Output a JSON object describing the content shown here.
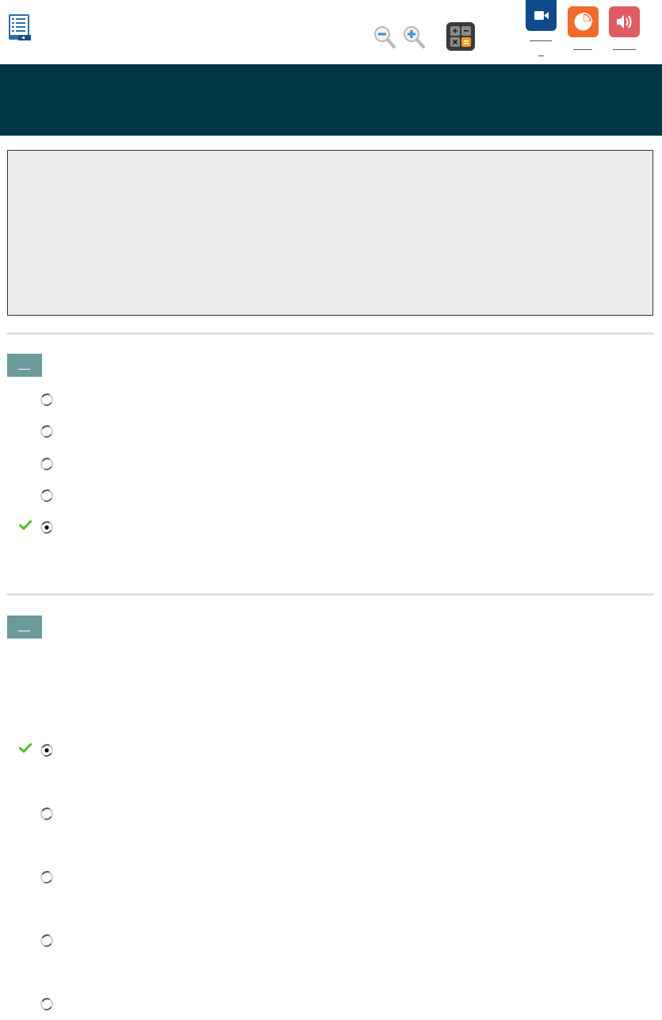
{
  "toolbar": {
    "icons": [
      "table-of-contents-icon",
      "zoom-out-icon",
      "zoom-in-icon",
      "calculator-icon",
      "video-icon",
      "chart-icon",
      "audio-icon"
    ]
  },
  "colors": {
    "banner": "#023747",
    "video": "#0e4a8c",
    "chart": "#f06a2c",
    "audio": "#e05c63",
    "question_number_bg": "#6a9a9a",
    "passage_bg": "#ececec",
    "check": "#55bb2a"
  },
  "questions": [
    {
      "options": [
        {
          "selected": false,
          "correct_mark": false
        },
        {
          "selected": false,
          "correct_mark": false
        },
        {
          "selected": false,
          "correct_mark": false
        },
        {
          "selected": false,
          "correct_mark": false
        },
        {
          "selected": true,
          "correct_mark": true
        }
      ]
    },
    {
      "options": [
        {
          "selected": true,
          "correct_mark": true
        },
        {
          "selected": false,
          "correct_mark": false
        },
        {
          "selected": false,
          "correct_mark": false
        },
        {
          "selected": false,
          "correct_mark": false
        },
        {
          "selected": false,
          "correct_mark": false
        }
      ]
    }
  ]
}
